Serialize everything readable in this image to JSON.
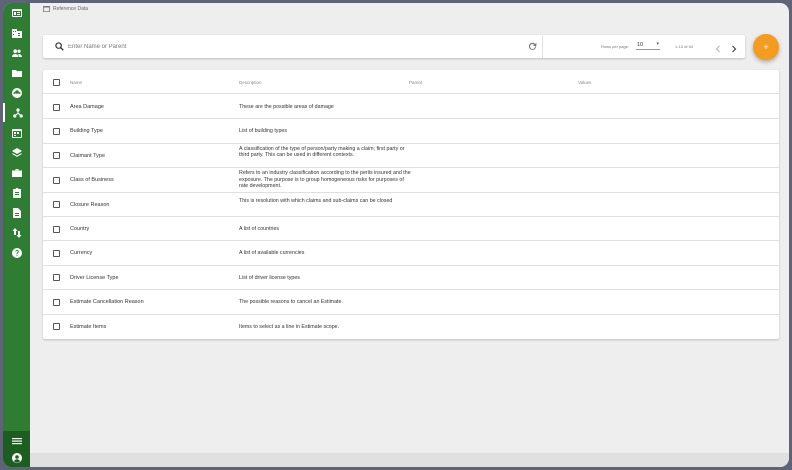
{
  "header": {
    "breadcrumb": "Reference Data"
  },
  "search": {
    "placeholder": "Enter Name or Parent",
    "value": ""
  },
  "pagination": {
    "rows_label": "Rows per page:",
    "rows_value": "10",
    "range": "1-10 of 54"
  },
  "fab": {
    "label": "+"
  },
  "table": {
    "columns": [
      "Name",
      "Description",
      "Parent",
      "Values"
    ],
    "rows": [
      {
        "name": "Area Damage",
        "description": "These are the possible areas of damage"
      },
      {
        "name": "Building Type",
        "description": "List of building types"
      },
      {
        "name": "Claimant Type",
        "description": "A classification of the type of person/party making a claim; first party or third party. This can be used in different contexts."
      },
      {
        "name": "Class of Business",
        "description": "Refers to an industry classification according to the perils insured and the exposure. The purpose is to group homogeneous risks for purposes of rate development."
      },
      {
        "name": "Closure Reason",
        "description": "This is resolution with which claims and sub-claims can be closed"
      },
      {
        "name": "Country",
        "description": "A list of countries"
      },
      {
        "name": "Currency",
        "description": "A list of available currencies"
      },
      {
        "name": "Driver License Type",
        "description": "List of driver license types"
      },
      {
        "name": "Estimate Cancellation Reason",
        "description": "The possible reasons to cancel an Estimate."
      },
      {
        "name": "Estimate Items",
        "description": "Items to select as a line in Estimate scope."
      }
    ]
  },
  "icons": {
    "sidebar": [
      "dashboard-icon",
      "business-icon",
      "people-icon",
      "folder-icon",
      "account-circle-icon",
      "hierarchy-icon",
      "calendar-icon",
      "layers-icon",
      "briefcase-icon",
      "clipboard-icon",
      "document-icon",
      "swap-icon",
      "help-icon"
    ],
    "sidebar_bottom": [
      "menu-icon",
      "user-icon"
    ]
  },
  "colors": {
    "sidebar": "#2e7d32",
    "sidebar_dark": "#1b5e20",
    "accent": "#f39c1d"
  }
}
